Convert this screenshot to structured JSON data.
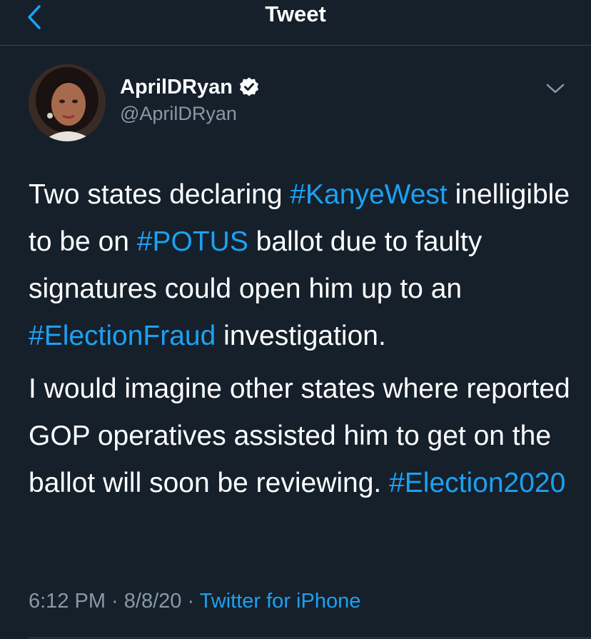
{
  "nav": {
    "title": "Tweet"
  },
  "author": {
    "display_name": "AprilDRyan",
    "handle": "@AprilDRyan",
    "verified": true
  },
  "tweet": {
    "para1": {
      "t1": "Two states declaring ",
      "h1": "#KanyeWest",
      "t2": " inelligible to be on ",
      "h2": "#POTUS",
      "t3": " ballot due to faulty signatures could open him up to an ",
      "h3": "#ElectionFraud",
      "t4": " investigation."
    },
    "para2": {
      "t1": "I would imagine other states where reported GOP operatives assisted him to get on the ballot will soon be reviewing. ",
      "h1": "#Election2020"
    }
  },
  "meta": {
    "time": "6:12 PM",
    "sep1": " · ",
    "date": "8/8/20",
    "sep2": " · ",
    "source": "Twitter for iPhone"
  },
  "colors": {
    "background": "#15202b",
    "accent": "#1da1f2",
    "secondary_text": "#8899a6",
    "divider": "#38444d"
  },
  "icons": {
    "back": "chevron-left-icon",
    "verified": "verified-badge-icon",
    "more": "chevron-down-icon"
  }
}
